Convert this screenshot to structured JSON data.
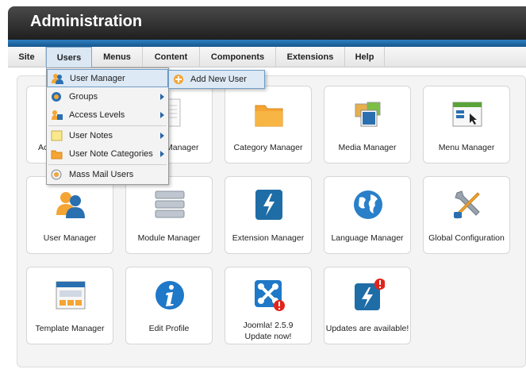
{
  "header": {
    "title": "Administration"
  },
  "menu": {
    "items": [
      {
        "label": "Site"
      },
      {
        "label": "Users"
      },
      {
        "label": "Menus"
      },
      {
        "label": "Content"
      },
      {
        "label": "Components"
      },
      {
        "label": "Extensions"
      },
      {
        "label": "Help"
      }
    ],
    "active": "Users"
  },
  "dropdown": {
    "items": [
      {
        "label": "User Manager",
        "icon": "user-icon"
      },
      {
        "label": "Groups",
        "icon": "groups-icon"
      },
      {
        "label": "Access Levels",
        "icon": "access-levels-icon"
      },
      {
        "label": "User Notes",
        "icon": "notes-icon"
      },
      {
        "label": "User Note Categories",
        "icon": "note-categories-icon"
      },
      {
        "label": "Mass Mail Users",
        "icon": "mail-icon"
      }
    ],
    "submenu": {
      "label": "Add New User",
      "icon": "add-icon"
    }
  },
  "tiles": {
    "row1": [
      {
        "label": "Ac"
      },
      {
        "label": "Manager"
      },
      {
        "label": "Category Manager"
      },
      {
        "label": "Media Manager"
      },
      {
        "label": "Menu Manager"
      }
    ],
    "row2": [
      {
        "label": "User Manager"
      },
      {
        "label": "Module Manager"
      },
      {
        "label": "Extension Manager"
      },
      {
        "label": "Language Manager"
      },
      {
        "label": "Global Configuration"
      }
    ],
    "row3": [
      {
        "label": "Template Manager"
      },
      {
        "label": "Edit Profile"
      },
      {
        "label1": "Joomla! 2.5.9",
        "label2": "Update now!"
      },
      {
        "label": "Updates are available!"
      }
    ]
  },
  "colors": {
    "accent_blue": "#2a6fb0",
    "header_dark": "#2b2b2b",
    "folder_orange": "#f4a533",
    "alert_red": "#e0251b"
  }
}
